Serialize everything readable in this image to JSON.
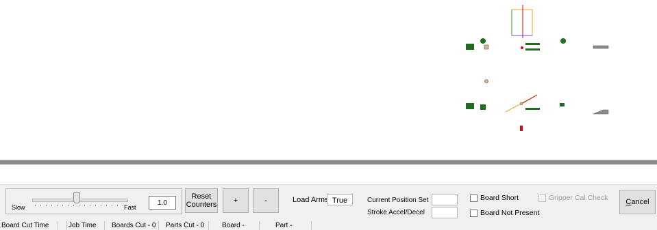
{
  "controls": {
    "slider": {
      "slow_label": "Slow",
      "fast_label": "Fast",
      "value": "1.0"
    },
    "reset_button": {
      "line1": "Reset",
      "line2": "Counters"
    },
    "plus_button": "+",
    "minus_button": "-",
    "load_arms": {
      "label": "Load Arms",
      "value": "True"
    },
    "current_position_label": "Current Position Set",
    "stroke_label": "Stroke Accel/Decel",
    "board_short_label": "Board Short",
    "board_not_present_label": "Board Not Present",
    "gripper_cal_label": "Gripper Cal Check",
    "cancel_button": {
      "accel": "C",
      "rest": "ancel"
    }
  },
  "status_bar": [
    "Board Cut Time",
    "Job Time",
    "Boards Cut - 0",
    "Parts Cut - 0",
    "Board -",
    "Part -"
  ],
  "colors": {
    "green": "#1f6b1f",
    "red": "#cc1111",
    "gray": "#8c8c8c",
    "tan": "#d9b48a",
    "blue": "#5555ee",
    "orange": "#f0a030"
  }
}
